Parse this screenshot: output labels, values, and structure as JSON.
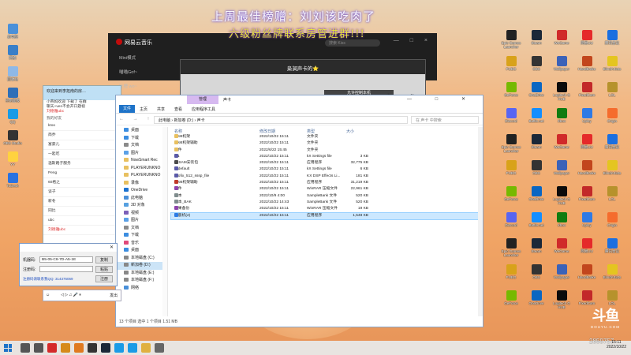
{
  "overlay": {
    "line1": "上周最佳榜赠：刘刘该吃肉了",
    "line2": "六级粉丝牌联系房管进群!!!"
  },
  "desktop_icons_left": [
    {
      "label": "此电脑",
      "color": "#4a90d9"
    },
    {
      "label": "网络",
      "color": "#3a7fc8"
    },
    {
      "label": "回收站",
      "color": "#8fb8e6"
    },
    {
      "label": "控制面板",
      "color": "#2f6fb8"
    },
    {
      "label": "QQ",
      "color": "#1a9be6"
    },
    {
      "label": "OBS Studio",
      "color": "#333333"
    },
    {
      "label": "YY",
      "color": "#ffd23f"
    },
    {
      "label": "ToDesk",
      "color": "#2a72e0"
    }
  ],
  "desktop_icons_right": [
    {
      "label": "Epic Games Launcher",
      "color": "#222222"
    },
    {
      "label": "Steam",
      "color": "#1b2838"
    },
    {
      "label": "WeGame",
      "color": "#d02a2a"
    },
    {
      "label": "网易UU",
      "color": "#e52a2a"
    },
    {
      "label": "腾讯会议",
      "color": "#1b6fe0"
    },
    {
      "label": "PUBG",
      "color": "#d8a21a"
    },
    {
      "label": "OBS",
      "color": "#333333"
    },
    {
      "label": "Wallpaper",
      "color": "#3b62b8"
    },
    {
      "label": "HandBrake",
      "color": "#c2461d"
    },
    {
      "label": "BlindArtists",
      "color": "#e4c520"
    },
    {
      "label": "GeForce",
      "color": "#76b900"
    },
    {
      "label": "OneDrive",
      "color": "#0a66c2"
    },
    {
      "label": "Logitech G HUB",
      "color": "#0b0b0b"
    },
    {
      "label": "FixedCam",
      "color": "#c22929"
    },
    {
      "label": "LOL",
      "color": "#b6922c"
    },
    {
      "label": "Discord",
      "color": "#5865f2"
    },
    {
      "label": "Battle.net",
      "color": "#148eff"
    },
    {
      "label": "Xbox",
      "color": "#107c10"
    },
    {
      "label": "Uplay",
      "color": "#2f7ae5"
    },
    {
      "label": "Origin",
      "color": "#f56c2d"
    }
  ],
  "music_app": {
    "title": "网易云音乐",
    "search_placeholder": "搜索 Kiss",
    "sidebar": [
      "Mini模式",
      "喵喵Gof~",
      "吐槽 wo~"
    ],
    "window_controls": "— □ ×"
  },
  "live_popup": {
    "title": "枭涧声卡的⭐",
    "button": "允许控制本机"
  },
  "qq_window": {
    "bar_text": "欢迎来到李拓南的房…",
    "messages": [
      "小燕妈欢迎 下载了 在群",
      "聊天+ven不会开口题视",
      "刘德雅ubc"
    ],
    "section_label": "我的好友",
    "contacts": [
      "ktoo",
      "简乔",
      "富豪儿",
      "一起吃",
      "温斯路子服务",
      "Peng",
      "60格之",
      "谈子",
      "新冬",
      "同比",
      "ubc",
      "刘德雅ubc"
    ]
  },
  "explorer": {
    "tab_manage": "管理",
    "tab_title": "声卡",
    "ribbon": [
      "文件",
      "主页",
      "共享",
      "查看",
      "应用程序工具"
    ],
    "nav_buttons": "← → ↑",
    "path": "此电脑 › 新加卷 (D:) › 声卡",
    "search_placeholder": "在 声卡 中搜索",
    "columns": {
      "name": "名称",
      "date": "修改日期",
      "type": "类型",
      "size": "大小"
    },
    "nav_items": [
      {
        "label": "桌面",
        "color": "#3b8de0"
      },
      {
        "label": "下载",
        "color": "#3b8de0"
      },
      {
        "label": "文档",
        "color": "#8a8a8a"
      },
      {
        "label": "图片",
        "color": "#5aa0e6"
      },
      {
        "label": "NowSmart Rec",
        "color": "#e8c060"
      },
      {
        "label": "PLAYERUNKNO",
        "color": "#e8c060"
      },
      {
        "label": "PLAYERUNKNO",
        "color": "#e8c060"
      },
      {
        "label": "录像",
        "color": "#e8c060"
      },
      {
        "label": "OneDrive",
        "color": "#1c72d0"
      },
      {
        "label": "此电脑",
        "color": "#4a90d9"
      },
      {
        "label": "3D 对象",
        "color": "#56a0e0"
      },
      {
        "label": "视频",
        "color": "#7b5fb8"
      },
      {
        "label": "图片",
        "color": "#5aa0e6"
      },
      {
        "label": "文档",
        "color": "#8a8a8a"
      },
      {
        "label": "下载",
        "color": "#3b8de0"
      },
      {
        "label": "音乐",
        "color": "#e0497a"
      },
      {
        "label": "桌面",
        "color": "#3b8de0"
      },
      {
        "label": "本地磁盘 (C:)",
        "color": "#888888"
      },
      {
        "label": "新加卷 (D:)",
        "color": "#888888"
      },
      {
        "label": "本地磁盘 (E:)",
        "color": "#888888"
      },
      {
        "label": "本地磁盘 (F:)",
        "color": "#888888"
      },
      {
        "label": "网络",
        "color": "#4a90d9"
      }
    ],
    "files": [
      {
        "name": "SAM机架",
        "date": "2022/10/22 15:11",
        "type": "文件夹",
        "size": "",
        "color": "#e8c060"
      },
      {
        "name": "SAM机架辅助",
        "date": "2022/10/22 15:11",
        "type": "文件夹",
        "size": "",
        "color": "#e8c060"
      },
      {
        "name": "插件",
        "date": "2022/6/22 15:45",
        "type": "文件夹",
        "size": "",
        "color": "#e8c060"
      },
      {
        "name": "7.1",
        "date": "2022/10/22 15:11",
        "type": "kX Settings file",
        "size": "3 KB",
        "color": "#5a5aa8"
      },
      {
        "name": "JZSAM安装包",
        "date": "2022/10/22 15:11",
        "type": "应用程序",
        "size": "32,775 KB",
        "color": "#4a4a4a"
      },
      {
        "name": "kxdefault",
        "date": "2022/10/22 15:11",
        "type": "kX Settings file",
        "size": "6 KB",
        "color": "#5a5aa8"
      },
      {
        "name": "Profix_512_sssp_file",
        "date": "2022/10/22 15:11",
        "type": "KX DSP Effects Li...",
        "size": "181 KB",
        "color": "#5a5aa8"
      },
      {
        "name": "SAM机架辅助",
        "date": "2022/10/22 15:11",
        "type": "应用程序",
        "size": "31,219 KB",
        "color": "#c0392b"
      },
      {
        "name": "插件",
        "date": "2022/10/22 15:11",
        "type": "WinRAR 压缩文件",
        "size": "22,961 KB",
        "color": "#8e44ad"
      },
      {
        "name": "双本",
        "date": "2022/10/9 4:00",
        "type": "SampleBank 文件",
        "size": "520 KB",
        "color": "#7f8c8d"
      },
      {
        "name": "双本_BAK",
        "date": "2022/10/22 14:43",
        "type": "SampleBank 文件",
        "size": "520 KB",
        "color": "#7f8c8d"
      },
      {
        "name": "效果备份",
        "date": "2022/10/22 15:11",
        "type": "WinRAR 压缩文件",
        "size": "19 KB",
        "color": "#8e44ad"
      },
      {
        "name": "注册机(2)",
        "date": "2022/10/22 15:11",
        "type": "应用程序",
        "size": "1,548 KB",
        "color": "#2c7be5"
      }
    ],
    "selected_index": 12,
    "status": "13 个项目   选中 1 个项目 1.51 MB"
  },
  "register_dialog": {
    "machine_label": "机器码:",
    "machine_value": "B5-05-C8-7D-A5-1E",
    "copy_button": "复制",
    "reg_label": "注册码:",
    "reg_value": "",
    "paste_button": "粘贴",
    "register_button": "注册",
    "link": "注册码请联系我QQ: 314376069"
  },
  "media_bar": {
    "controls": "◁ ▷ ♫ 🎤 ⏸",
    "share_label": "发出"
  },
  "watermark": {
    "brand": "斗鱼",
    "sub": "DOUYU.COM"
  },
  "view_count": "2859757",
  "clock": {
    "time": "15:11",
    "date": "2022/10/22"
  },
  "taskbar": [
    {
      "name": "search",
      "color": "#555555"
    },
    {
      "name": "task-view",
      "color": "#555555"
    },
    {
      "name": "netease-music",
      "color": "#d42a2a"
    },
    {
      "name": "game",
      "color": "#d68a1a"
    },
    {
      "name": "orange-app",
      "color": "#e07a20"
    },
    {
      "name": "obs",
      "color": "#333333"
    },
    {
      "name": "steam",
      "color": "#1b2838"
    },
    {
      "name": "qq",
      "color": "#1a9be6"
    },
    {
      "name": "qq2",
      "color": "#1a9be6"
    },
    {
      "name": "explorer",
      "color": "#e0b040"
    },
    {
      "name": "kx",
      "color": "#666666"
    }
  ]
}
